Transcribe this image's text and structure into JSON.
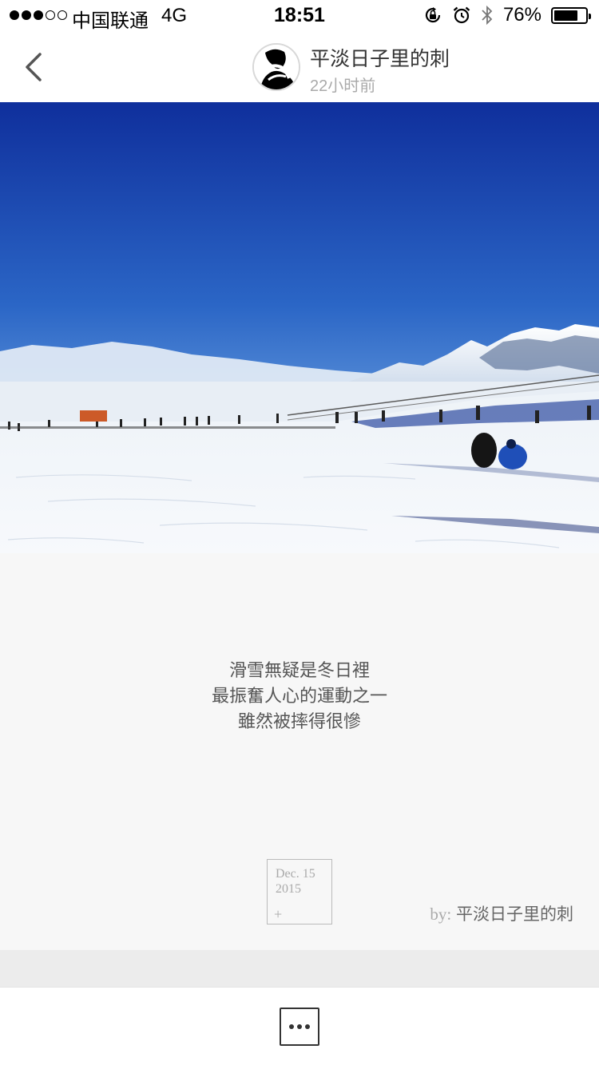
{
  "status_bar": {
    "carrier": "中国联通",
    "network": "4G",
    "time": "18:51",
    "battery_percent": "76%",
    "battery_level": 0.76,
    "signal_bars_filled": 3,
    "signal_bars_total": 5
  },
  "header": {
    "author_name": "平淡日子里的刺",
    "post_time": "22小时前"
  },
  "post": {
    "text_lines": [
      "滑雪無疑是冬日裡",
      "最振奮人心的運動之一",
      "雖然被摔得很慘"
    ],
    "date_month_day": "Dec. 15",
    "date_year": "2015",
    "date_plus": "+",
    "by_label": "by:",
    "by_name": "平淡日子里的刺"
  },
  "icons": [
    "back-icon",
    "avatar",
    "orientation-lock-icon",
    "alarm-icon",
    "bluetooth-icon",
    "battery-icon",
    "more-icon"
  ],
  "colors": {
    "sky_top": "#0f2f9c",
    "sky_bottom": "#7fb0e6",
    "card_background": "#f7f7f7",
    "band_gray": "#ececec"
  }
}
